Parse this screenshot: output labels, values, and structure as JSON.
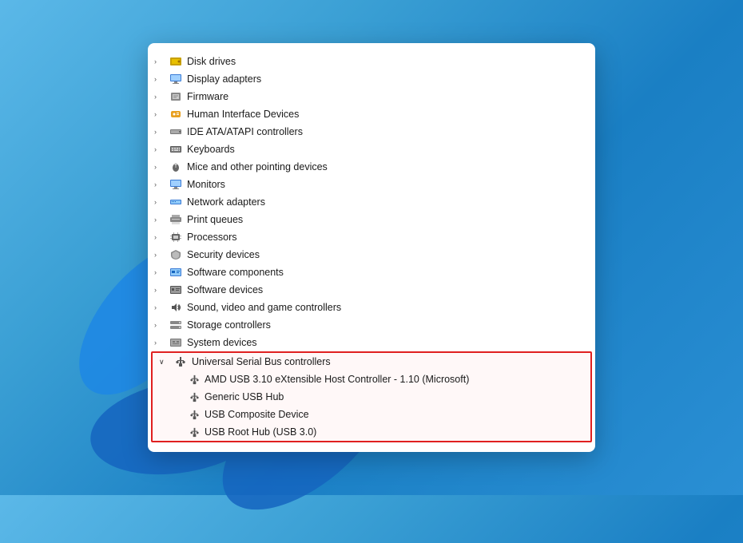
{
  "panel": {
    "items": [
      {
        "id": "disk-drives",
        "label": "Disk drives",
        "icon": "💽",
        "expanded": false,
        "indent": 0
      },
      {
        "id": "display-adapters",
        "label": "Display adapters",
        "icon": "🖥",
        "expanded": false,
        "indent": 0
      },
      {
        "id": "firmware",
        "label": "Firmware",
        "icon": "⚙",
        "expanded": false,
        "indent": 0
      },
      {
        "id": "hid",
        "label": "Human Interface Devices",
        "icon": "🎮",
        "expanded": false,
        "indent": 0
      },
      {
        "id": "ide",
        "label": "IDE ATA/ATAPI controllers",
        "icon": "🔲",
        "expanded": false,
        "indent": 0
      },
      {
        "id": "keyboards",
        "label": "Keyboards",
        "icon": "⌨",
        "expanded": false,
        "indent": 0
      },
      {
        "id": "mice",
        "label": "Mice and other pointing devices",
        "icon": "🖱",
        "expanded": false,
        "indent": 0
      },
      {
        "id": "monitors",
        "label": "Monitors",
        "icon": "🖥",
        "expanded": false,
        "indent": 0
      },
      {
        "id": "network",
        "label": "Network adapters",
        "icon": "🌐",
        "expanded": false,
        "indent": 0
      },
      {
        "id": "print",
        "label": "Print queues",
        "icon": "🖨",
        "expanded": false,
        "indent": 0
      },
      {
        "id": "processors",
        "label": "Processors",
        "icon": "⚙",
        "expanded": false,
        "indent": 0
      },
      {
        "id": "security",
        "label": "Security devices",
        "icon": "🔒",
        "expanded": false,
        "indent": 0
      },
      {
        "id": "softcomp",
        "label": "Software components",
        "icon": "💻",
        "expanded": false,
        "indent": 0
      },
      {
        "id": "software",
        "label": "Software devices",
        "icon": "💻",
        "expanded": false,
        "indent": 0
      },
      {
        "id": "sound",
        "label": "Sound, video and game controllers",
        "icon": "🔊",
        "expanded": false,
        "indent": 0
      },
      {
        "id": "storage",
        "label": "Storage controllers",
        "icon": "💾",
        "expanded": false,
        "indent": 0
      },
      {
        "id": "system",
        "label": "System devices",
        "icon": "⚙",
        "expanded": false,
        "indent": 0
      }
    ],
    "usb_section": {
      "parent": {
        "id": "usb-controllers",
        "label": "Universal Serial Bus controllers",
        "icon": "🔌",
        "expanded": true
      },
      "children": [
        {
          "id": "amd-usb",
          "label": "AMD USB 3.10 eXtensible Host Controller - 1.10 (Microsoft)",
          "icon": "🔌"
        },
        {
          "id": "generic-hub",
          "label": "Generic USB Hub",
          "icon": "🔌"
        },
        {
          "id": "usb-composite",
          "label": "USB Composite Device",
          "icon": "🔌"
        },
        {
          "id": "usb-root-hub",
          "label": "USB Root Hub (USB 3.0)",
          "icon": "🔌"
        }
      ]
    }
  }
}
